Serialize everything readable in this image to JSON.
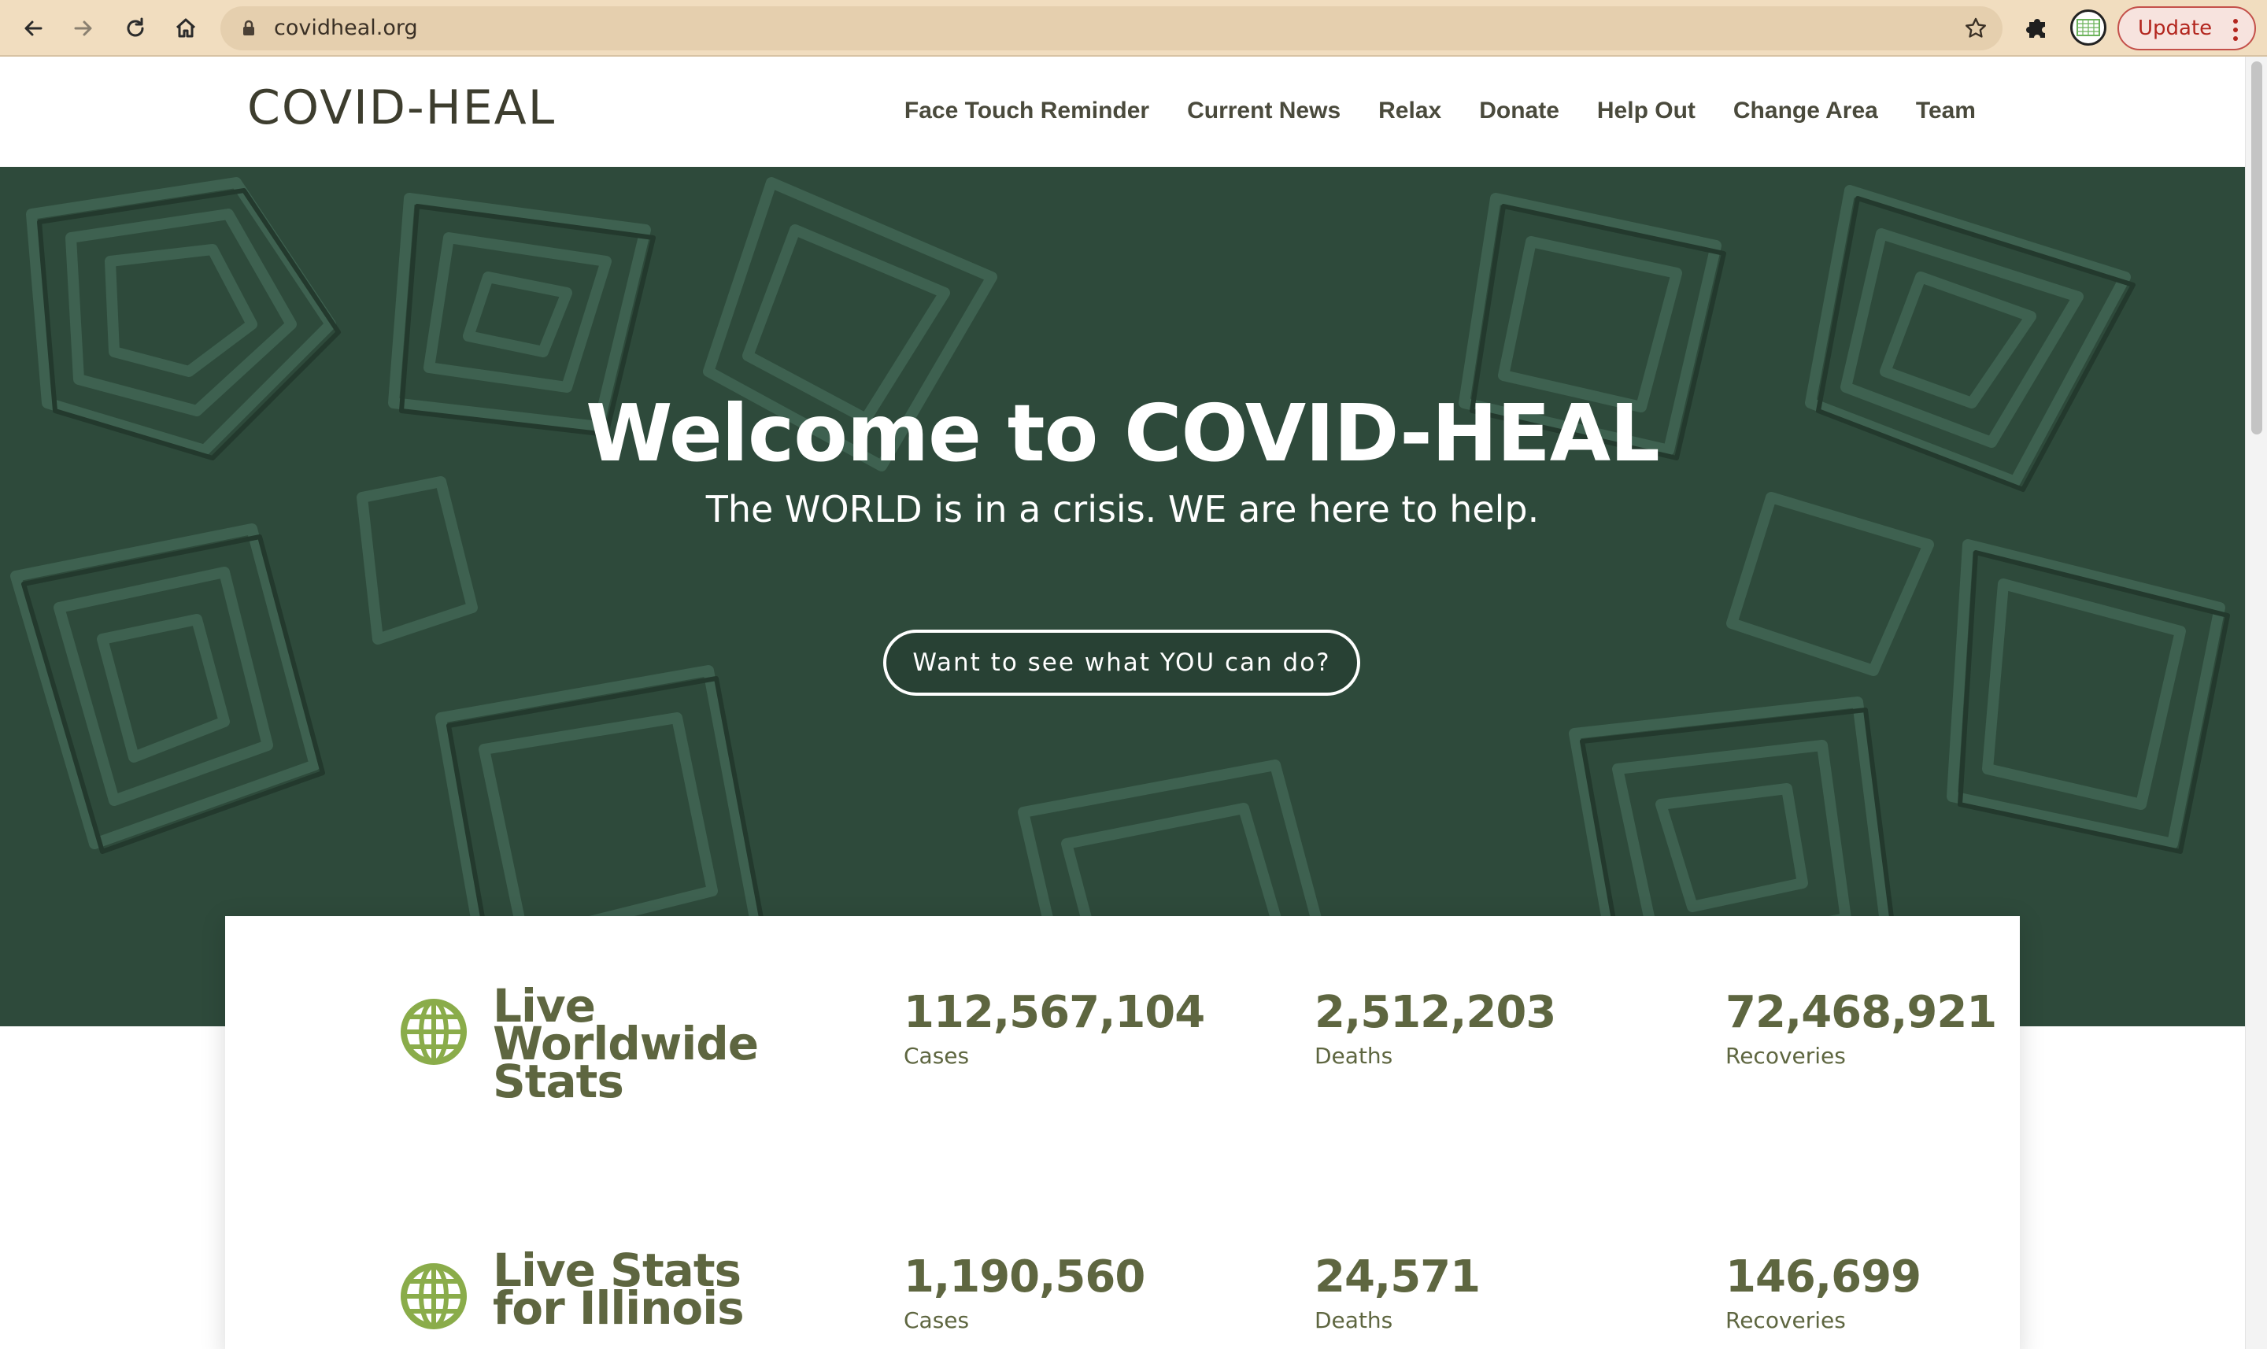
{
  "browser": {
    "url": "covidheal.org",
    "update_label": "Update"
  },
  "site": {
    "logo": "COVID-HEAL",
    "menu": [
      {
        "label": "Face Touch Reminder"
      },
      {
        "label": "Current News"
      },
      {
        "label": "Relax"
      },
      {
        "label": "Donate"
      },
      {
        "label": "Help Out"
      },
      {
        "label": "Change Area"
      },
      {
        "label": "Team"
      }
    ]
  },
  "hero": {
    "title": "Welcome to COVID-HEAL",
    "subtitle": "The WORLD is in a crisis. WE are here to help.",
    "cta": "Want to see what YOU can do?",
    "background_color": "#2e4a3b"
  },
  "stats": {
    "worldwide": {
      "heading_lines": [
        "Live",
        "Worldwide",
        "Stats"
      ],
      "cases": "112,567,104",
      "cases_label": "Cases",
      "deaths": "2,512,203",
      "deaths_label": "Deaths",
      "recoveries": "72,468,921",
      "recoveries_label": "Recoveries"
    },
    "illinois": {
      "heading_lines": [
        "Live Stats",
        "for Illinois"
      ],
      "cases": "1,190,560",
      "cases_label": "Cases",
      "deaths": "24,571",
      "deaths_label": "Deaths",
      "recoveries": "146,699",
      "recoveries_label": "Recoveries"
    },
    "accent_color": "#5e6640",
    "icon_color": "#8aac4a"
  }
}
